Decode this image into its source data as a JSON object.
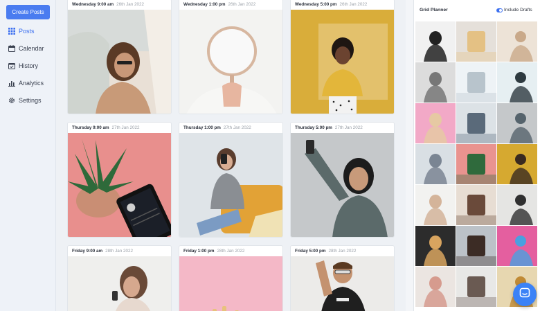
{
  "sidebar": {
    "create_label": "Create Posts",
    "items": [
      {
        "label": "Posts",
        "icon": "grid-icon",
        "active": true
      },
      {
        "label": "Calendar",
        "icon": "calendar-icon",
        "active": false
      },
      {
        "label": "History",
        "icon": "history-icon",
        "active": false
      },
      {
        "label": "Analytics",
        "icon": "analytics-icon",
        "active": false
      },
      {
        "label": "Settings",
        "icon": "gear-icon",
        "active": false
      }
    ]
  },
  "feed": {
    "cards": [
      {
        "day": "Wednesday 9:00 am",
        "date": "26th Jan 2022",
        "photo": "woman-sunglasses-photo",
        "bg": "#e7ddd3"
      },
      {
        "day": "Wednesday 1:00 pm",
        "date": "26th Jan 2022",
        "photo": "hand-mirror-photo",
        "bg": "#f2f2f0"
      },
      {
        "day": "Wednesday 5:00 pm",
        "date": "26th Jan 2022",
        "photo": "woman-yellow-wall-photo",
        "bg": "#d6a930"
      },
      {
        "day": "Thursday 9:00 am",
        "date": "27th Jan 2022",
        "photo": "plant-phone-photo",
        "bg": "#e9938f"
      },
      {
        "day": "Thursday 1:00 pm",
        "date": "27th Jan 2022",
        "photo": "woman-couch-selfie-photo",
        "bg": "#d9dfe4"
      },
      {
        "day": "Thursday 5:00 pm",
        "date": "27th Jan 2022",
        "photo": "woman-hijab-selfie-photo",
        "bg": "#c3c6c8"
      },
      {
        "day": "Friday 9:00 am",
        "date": "28th Jan 2022",
        "photo": "woman-phone-photo",
        "bg": "#eeeeec"
      },
      {
        "day": "Friday 1:00 pm",
        "date": "28th Jan 2022",
        "photo": "pink-backdrop-photo",
        "bg": "#f4b7c6"
      },
      {
        "day": "Friday 5:00 pm",
        "date": "28th Jan 2022",
        "photo": "man-pointing-photo",
        "bg": "#eceae8"
      }
    ]
  },
  "planner": {
    "title": "Grid Planner",
    "drafts_label": "Include Drafts",
    "drafts_on": true,
    "tiles": [
      {
        "name": "camera-tile",
        "c1": "#f1f1f1",
        "c2": "#222222"
      },
      {
        "name": "figurine-tile",
        "c1": "#e5e0da",
        "c2": "#e4c184"
      },
      {
        "name": "polaroid-tile",
        "c1": "#ede3d7",
        "c2": "#c9a98a"
      },
      {
        "name": "figurine-bw-tile",
        "c1": "#dcdcdc",
        "c2": "#777777"
      },
      {
        "name": "laptop-tile",
        "c1": "#eef3f6",
        "c2": "#b8c4cc"
      },
      {
        "name": "man-stool-tile",
        "c1": "#e6eff2",
        "c2": "#2e3a40"
      },
      {
        "name": "hashtag-pink-tile",
        "c1": "#f2a9c7",
        "c2": "#e6c9a3"
      },
      {
        "name": "woman-couch-tile",
        "c1": "#dce2e6",
        "c2": "#5a6a7a"
      },
      {
        "name": "woman-hijab-tile",
        "c1": "#c5c8ca",
        "c2": "#55636c"
      },
      {
        "name": "woman-couch-2-tile",
        "c1": "#d9dfe4",
        "c2": "#7a8593"
      },
      {
        "name": "plant-tile",
        "c1": "#e9938f",
        "c2": "#2f6a3c"
      },
      {
        "name": "woman-yellow-tile",
        "c1": "#d6a930",
        "c2": "#3a2a20"
      },
      {
        "name": "mirror-tile",
        "c1": "#f2f2f0",
        "c2": "#d4b49a"
      },
      {
        "name": "woman-laugh-tile",
        "c1": "#e7ddd3",
        "c2": "#6a4a3a"
      },
      {
        "name": "man-tile",
        "c1": "#e5e5e3",
        "c2": "#303030"
      },
      {
        "name": "hashtag-dark-tile",
        "c1": "#2c2c2c",
        "c2": "#d8a45f"
      },
      {
        "name": "woman-dark-tile",
        "c1": "#bcc2c8",
        "c2": "#3c2c25"
      },
      {
        "name": "colorful-tile",
        "c1": "#e45f9f",
        "c2": "#4aa0e0"
      },
      {
        "name": "phone-tile",
        "c1": "#ebe5e1",
        "c2": "#d69b8e"
      },
      {
        "name": "woman-sitting-tile",
        "c1": "#e8e8e6",
        "c2": "#6a5a52"
      },
      {
        "name": "woman-yellow-2-tile",
        "c1": "#e7d7b0",
        "c2": "#c08a35"
      }
    ]
  }
}
